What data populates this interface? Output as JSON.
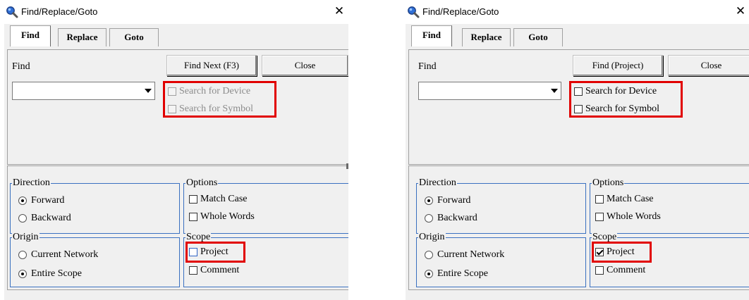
{
  "dialogs": [
    {
      "title": "Find/Replace/Goto",
      "tabs": [
        {
          "label": "Find"
        },
        {
          "label": "Replace"
        },
        {
          "label": "Goto"
        }
      ],
      "find_label": "Find",
      "find_value": "",
      "buttons": {
        "primary": "Find Next (F3)",
        "close": "Close"
      },
      "search_device": {
        "label": "Search for Device",
        "checked": false,
        "enabled": false
      },
      "search_symbol": {
        "label": "Search for Symbol",
        "checked": false,
        "enabled": false
      },
      "direction": {
        "title": "Direction",
        "options": [
          "Forward",
          "Backward"
        ],
        "selected": "Forward"
      },
      "options": {
        "title": "Options",
        "match_case": "Match Case",
        "whole_words": "Whole Words"
      },
      "origin": {
        "title": "Origin",
        "options": [
          "Current Network",
          "Entire Scope"
        ],
        "selected": "Entire Scope"
      },
      "scope": {
        "title": "Scope",
        "project": "Project",
        "project_checked": false,
        "comment": "Comment"
      }
    },
    {
      "title": "Find/Replace/Goto",
      "tabs": [
        {
          "label": "Find"
        },
        {
          "label": "Replace"
        },
        {
          "label": "Goto"
        }
      ],
      "find_label": "Find",
      "find_value": "",
      "buttons": {
        "primary": "Find (Project)",
        "close": "Close"
      },
      "search_device": {
        "label": "Search for Device",
        "checked": false,
        "enabled": true
      },
      "search_symbol": {
        "label": "Search for Symbol",
        "checked": false,
        "enabled": true
      },
      "direction": {
        "title": "Direction",
        "options": [
          "Forward",
          "Backward"
        ],
        "selected": "Forward"
      },
      "options": {
        "title": "Options",
        "match_case": "Match Case",
        "whole_words": "Whole Words"
      },
      "origin": {
        "title": "Origin",
        "options": [
          "Current Network",
          "Entire Scope"
        ],
        "selected": "Entire Scope"
      },
      "scope": {
        "title": "Scope",
        "project": "Project",
        "project_checked": true,
        "comment": "Comment"
      }
    }
  ],
  "colors": {
    "highlight": "#e10000",
    "groupbox_border": "#3a70c0",
    "dialog_bg": "#f0f0f0"
  },
  "icons": {
    "title_icon": "magnifier-icon",
    "close": "close-icon"
  }
}
